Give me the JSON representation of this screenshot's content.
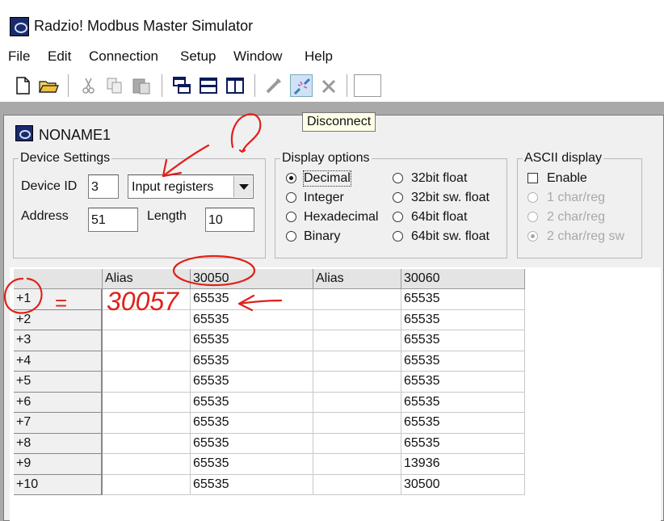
{
  "window": {
    "title": "Radzio! Modbus Master Simulator"
  },
  "menu": [
    "File",
    "Edit",
    "Connection",
    "Setup",
    "Window",
    "Help"
  ],
  "toolbar": {
    "tooltip": "Disconnect"
  },
  "child": {
    "title": "NONAME1",
    "device_settings": {
      "legend": "Device Settings",
      "device_id_label": "Device ID",
      "device_id": "3",
      "register_type": "Input registers",
      "address_label": "Address",
      "address": "51",
      "length_label": "Length",
      "length": "10"
    },
    "display_options": {
      "legend": "Display options",
      "options": [
        "Decimal",
        "Integer",
        "Hexadecimal",
        "Binary",
        "32bit float",
        "32bit sw. float",
        "64bit float",
        "64bit sw. float"
      ],
      "selected": "Decimal"
    },
    "ascii_display": {
      "legend": "ASCII display",
      "enable_label": "Enable",
      "options": [
        "1 char/reg",
        "2 char/reg",
        "2 char/reg sw"
      ],
      "selected": "2 char/reg sw"
    }
  },
  "grid": {
    "headers": [
      "",
      "Alias",
      "30050",
      "Alias",
      "30060"
    ],
    "rows": [
      {
        "label": "+1",
        "a": "",
        "v1": "65535",
        "b": "",
        "v2": "65535"
      },
      {
        "label": "+2",
        "a": "",
        "v1": "65535",
        "b": "",
        "v2": "65535"
      },
      {
        "label": "+3",
        "a": "",
        "v1": "65535",
        "b": "",
        "v2": "65535"
      },
      {
        "label": "+4",
        "a": "",
        "v1": "65535",
        "b": "",
        "v2": "65535"
      },
      {
        "label": "+5",
        "a": "",
        "v1": "65535",
        "b": "",
        "v2": "65535"
      },
      {
        "label": "+6",
        "a": "",
        "v1": "65535",
        "b": "",
        "v2": "65535"
      },
      {
        "label": "+7",
        "a": "",
        "v1": "65535",
        "b": "",
        "v2": "65535"
      },
      {
        "label": "+8",
        "a": "",
        "v1": "65535",
        "b": "",
        "v2": "65535"
      },
      {
        "label": "+9",
        "a": "",
        "v1": "65535",
        "b": "",
        "v2": "13936"
      },
      {
        "label": "+10",
        "a": "",
        "v1": "65535",
        "b": "",
        "v2": "30500"
      }
    ]
  },
  "annotations": {
    "handwritten_equals": "=",
    "handwritten_value": "30057",
    "question_mark": "?"
  }
}
